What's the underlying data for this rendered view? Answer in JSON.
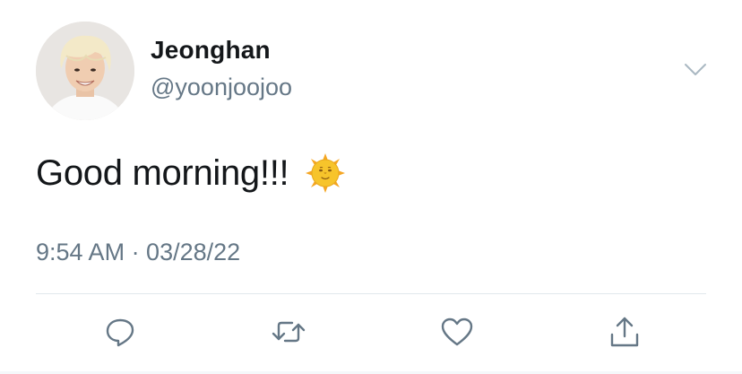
{
  "author": {
    "display_name": "Jeonghan",
    "handle": "@yoonjoojoo"
  },
  "tweet": {
    "text": "Good morning!!!",
    "emoji": "sun-with-face-icon",
    "timestamp": "9:54 AM · 03/28/22"
  },
  "actions": [
    "reply-icon",
    "retweet-icon",
    "like-icon",
    "share-icon"
  ],
  "colors": {
    "text": "#14171a",
    "secondary": "#657786",
    "icon": "#657786",
    "divider": "#e1e8ed",
    "sun": "#f7c42b"
  }
}
